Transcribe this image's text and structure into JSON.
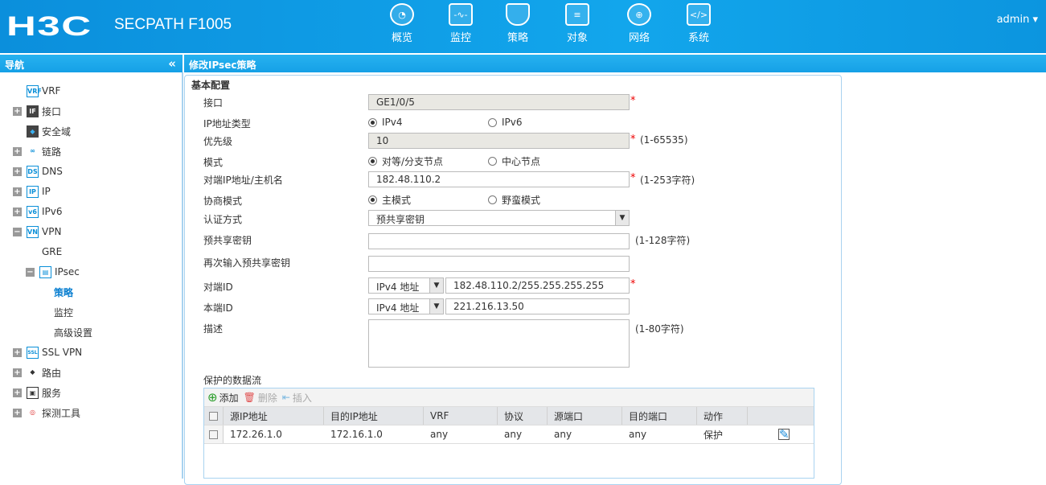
{
  "header": {
    "logo": "H3C",
    "product": "SECPATH F1005",
    "user": "admin",
    "menu": [
      {
        "label": "概览",
        "icon": "gauge-icon"
      },
      {
        "label": "监控",
        "icon": "monitor-icon"
      },
      {
        "label": "策略",
        "icon": "shield-icon"
      },
      {
        "label": "对象",
        "icon": "server-icon"
      },
      {
        "label": "网络",
        "icon": "globe-icon"
      },
      {
        "label": "系统",
        "icon": "code-icon"
      }
    ]
  },
  "nav": {
    "title": "导航",
    "items": [
      {
        "label": "VRF",
        "icon": "VRF"
      },
      {
        "label": "接口",
        "icon": "IF"
      },
      {
        "label": "安全域",
        "icon": "◆"
      },
      {
        "label": "链路",
        "icon": "∞"
      },
      {
        "label": "DNS",
        "icon": "DS"
      },
      {
        "label": "IP",
        "icon": "IP"
      },
      {
        "label": "IPv6",
        "icon": "v6"
      },
      {
        "label": "VPN",
        "icon": "VN"
      },
      {
        "label": "GRE"
      },
      {
        "label": "IPsec",
        "icon": "▤"
      },
      {
        "label": "策略"
      },
      {
        "label": "监控"
      },
      {
        "label": "高级设置"
      },
      {
        "label": "SSL VPN",
        "icon": "SSL"
      },
      {
        "label": "路由",
        "icon": "◆"
      },
      {
        "label": "服务",
        "icon": "▣"
      },
      {
        "label": "探测工具",
        "icon": "◎"
      }
    ]
  },
  "page": {
    "title": "修改IPsec策略",
    "section": "基本配置",
    "interface": {
      "label": "接口",
      "value": "GE1/0/5"
    },
    "ip_type": {
      "label": "IP地址类型",
      "options": [
        "IPv4",
        "IPv6"
      ],
      "selected": "IPv4"
    },
    "priority": {
      "label": "优先级",
      "value": "10",
      "hint": "(1-65535)"
    },
    "mode": {
      "label": "模式",
      "options": [
        "对等/分支节点",
        "中心节点"
      ],
      "selected": "对等/分支节点"
    },
    "peer_addr": {
      "label": "对端IP地址/主机名",
      "value": "182.48.110.2",
      "hint": "(1-253字符)"
    },
    "nego_mode": {
      "label": "协商模式",
      "options": [
        "主模式",
        "野蛮模式"
      ],
      "selected": "主模式"
    },
    "auth": {
      "label": "认证方式",
      "value": "预共享密钥"
    },
    "psk": {
      "label": "预共享密钥",
      "value": "",
      "hint": "(1-128字符)"
    },
    "psk2": {
      "label": "再次输入预共享密钥",
      "value": ""
    },
    "peer_id": {
      "label": "对端ID",
      "type": "IPv4 地址",
      "value": "182.48.110.2/255.255.255.255"
    },
    "local_id": {
      "label": "本端ID",
      "type": "IPv4 地址",
      "value": "221.216.13.50"
    },
    "desc": {
      "label": "描述",
      "value": "",
      "hint": "(1-80字符)"
    },
    "flows": {
      "label": "保护的数据流",
      "toolbar": {
        "add": "添加",
        "delete": "删除",
        "insert": "插入"
      },
      "columns": [
        "源IP地址",
        "目的IP地址",
        "VRF",
        "协议",
        "源端口",
        "目的端口",
        "动作"
      ],
      "rows": [
        [
          "172.26.1.0",
          "172.16.1.0",
          "any",
          "any",
          "any",
          "any",
          "保护"
        ]
      ]
    }
  }
}
